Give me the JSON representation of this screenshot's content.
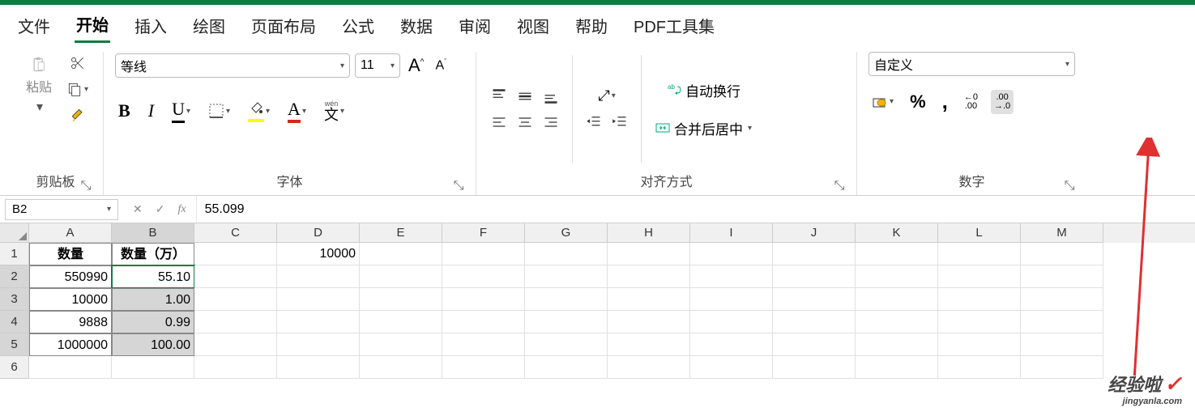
{
  "menu": {
    "file": "文件",
    "home": "开始",
    "insert": "插入",
    "draw": "绘图",
    "layout": "页面布局",
    "formula": "公式",
    "data": "数据",
    "review": "审阅",
    "view": "视图",
    "help": "帮助",
    "pdf": "PDF工具集"
  },
  "ribbon": {
    "clipboard": {
      "paste": "粘贴",
      "label": "剪贴板"
    },
    "font": {
      "name": "等线",
      "size": "11",
      "inc": "A",
      "dec": "A",
      "bold": "B",
      "italic": "I",
      "underline": "U",
      "phonetic_top": "wén",
      "phonetic": "文",
      "fill": "A",
      "color": "A",
      "label": "字体"
    },
    "align": {
      "wrap": "自动换行",
      "merge": "合并后居中",
      "label": "对齐方式"
    },
    "number": {
      "format": "自定义",
      "percent": "%",
      "comma": ",",
      "inc": "←0\n.00",
      "dec": ".00\n→.0",
      "label": "数字"
    }
  },
  "formula_bar": {
    "name_box": "B2",
    "fx": "fx",
    "value": "55.099"
  },
  "columns": [
    "A",
    "B",
    "C",
    "D",
    "E",
    "F",
    "G",
    "H",
    "I",
    "J",
    "K",
    "L",
    "M"
  ],
  "rows": [
    "1",
    "2",
    "3",
    "4",
    "5",
    "6"
  ],
  "grid": {
    "A1": "数量",
    "B1": "数量（万）",
    "D1": "10000",
    "A2": "550990",
    "B2": "55.10",
    "A3": "10000",
    "B3": "1.00",
    "A4": "9888",
    "B4": "0.99",
    "A5": "1000000",
    "B5": "100.00"
  },
  "chart_data": {
    "type": "table",
    "headers": [
      "数量",
      "数量（万）"
    ],
    "rows": [
      [
        550990,
        55.1
      ],
      [
        10000,
        1.0
      ],
      [
        9888,
        0.99
      ],
      [
        1000000,
        100.0
      ]
    ],
    "constant_D1": 10000
  },
  "watermark": {
    "text": "经验啦",
    "url": "jingyanla.com",
    "check": "✓"
  }
}
